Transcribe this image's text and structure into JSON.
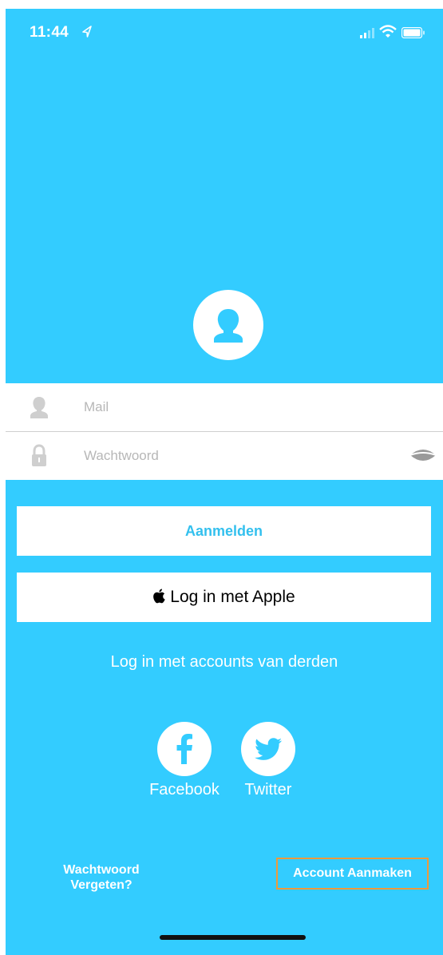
{
  "status_bar": {
    "time": "11:44",
    "icons": [
      "location-arrow-icon",
      "cellular-signal-icon",
      "wifi-icon",
      "battery-icon"
    ]
  },
  "header": {
    "avatar_icon": "user-avatar-icon"
  },
  "form": {
    "mail": {
      "placeholder": "Mail",
      "value": "",
      "icon": "user-icon"
    },
    "password": {
      "placeholder": "Wachtwoord",
      "value": "",
      "icon": "lock-icon",
      "toggle_icon": "eye-toggle-icon"
    }
  },
  "buttons": {
    "login_label": "Aanmelden",
    "apple_label": "Log in met Apple"
  },
  "third_party": {
    "heading": "Log in met accounts van derden",
    "providers": [
      {
        "label": "Facebook",
        "icon": "facebook-icon"
      },
      {
        "label": "Twitter",
        "icon": "twitter-icon"
      }
    ]
  },
  "footer": {
    "forgot_password": "Wachtwoord\nVergeten?",
    "create_account": "Account Aanmaken"
  },
  "colors": {
    "background": "#33ccff",
    "login_text": "#33c0ee",
    "highlight_border": "#f0993a"
  }
}
